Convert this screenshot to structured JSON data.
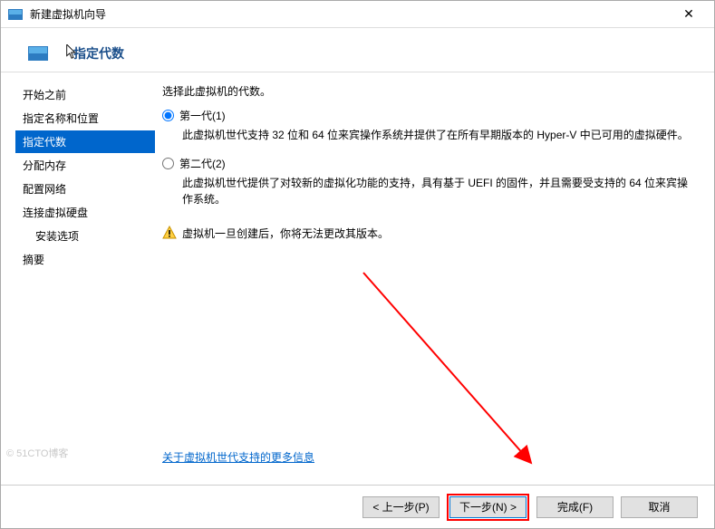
{
  "window": {
    "title": "新建虚拟机向导",
    "close_symbol": "✕"
  },
  "header": {
    "title": "指定代数"
  },
  "sidebar": {
    "items": [
      {
        "label": "开始之前"
      },
      {
        "label": "指定名称和位置"
      },
      {
        "label": "指定代数"
      },
      {
        "label": "分配内存"
      },
      {
        "label": "配置网络"
      },
      {
        "label": "连接虚拟硬盘"
      },
      {
        "label": "安装选项",
        "sub": true
      },
      {
        "label": "摘要"
      }
    ],
    "active_index": 2
  },
  "content": {
    "prompt": "选择此虚拟机的代数。",
    "options": [
      {
        "label": "第一代(1)",
        "desc": "此虚拟机世代支持 32 位和 64 位来宾操作系统并提供了在所有早期版本的 Hyper-V 中已可用的虚拟硬件。",
        "checked": true
      },
      {
        "label": "第二代(2)",
        "desc": "此虚拟机世代提供了对较新的虚拟化功能的支持，具有基于 UEFI 的固件，并且需要受支持的 64 位来宾操作系统。",
        "checked": false
      }
    ],
    "warning": "虚拟机一旦创建后，你将无法更改其版本。",
    "link": "关于虚拟机世代支持的更多信息"
  },
  "footer": {
    "prev": "< 上一步(P)",
    "next": "下一步(N) >",
    "finish": "完成(F)",
    "cancel": "取消"
  },
  "watermark": "© 51CTO博客"
}
